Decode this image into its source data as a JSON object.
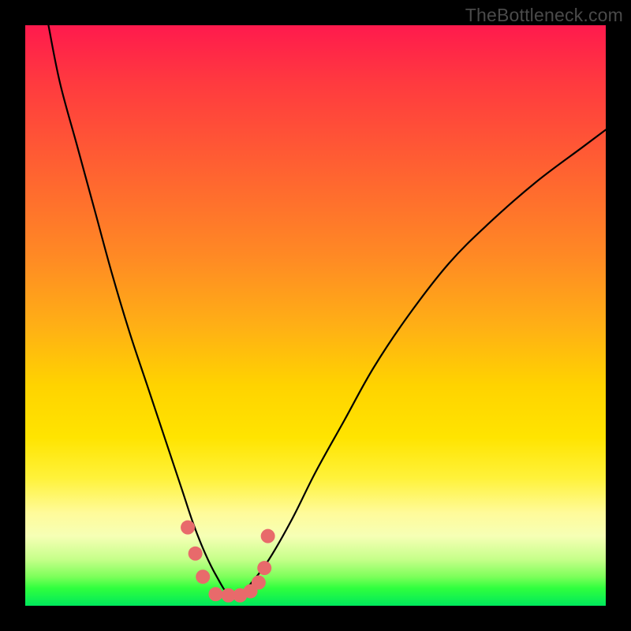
{
  "watermark": "TheBottleneck.com",
  "colors": {
    "frame_bg": "#000000",
    "curve_stroke": "#000000",
    "marker_fill": "#e86a6b",
    "marker_stroke": "#e86a6b",
    "gradient_stops": [
      {
        "pos": 0,
        "hex": "#ff1a4d"
      },
      {
        "pos": 10,
        "hex": "#ff3a3f"
      },
      {
        "pos": 25,
        "hex": "#ff6231"
      },
      {
        "pos": 40,
        "hex": "#ff8a24"
      },
      {
        "pos": 52,
        "hex": "#ffb015"
      },
      {
        "pos": 62,
        "hex": "#ffd300"
      },
      {
        "pos": 71,
        "hex": "#ffe400"
      },
      {
        "pos": 78,
        "hex": "#fff23a"
      },
      {
        "pos": 84,
        "hex": "#fffb9a"
      },
      {
        "pos": 88,
        "hex": "#f6ffb5"
      },
      {
        "pos": 92,
        "hex": "#c6ff8a"
      },
      {
        "pos": 95,
        "hex": "#7dff5a"
      },
      {
        "pos": 97,
        "hex": "#2fff3e"
      },
      {
        "pos": 100,
        "hex": "#00e85c"
      }
    ]
  },
  "chart_data": {
    "type": "line",
    "title": "",
    "xlabel": "",
    "ylabel": "",
    "xlim": [
      0,
      100
    ],
    "ylim": [
      0,
      100
    ],
    "note": "No axis tick labels are shown. x and y are estimated as percentages of the inner plot area; y=100 is top, y=0 is bottom. The curve resembles a bottleneck V-shape with its minimum near x≈35, and a cluster of marker points hugging the curve near the bottom of the dip.",
    "series": [
      {
        "name": "curve",
        "role": "line",
        "x": [
          4,
          6,
          9,
          12,
          15,
          18,
          21,
          24,
          27,
          29,
          31,
          33,
          35,
          37,
          39,
          42,
          46,
          50,
          55,
          60,
          66,
          73,
          80,
          88,
          96,
          100
        ],
        "y": [
          100,
          90,
          79,
          68,
          57,
          47,
          38,
          29,
          20,
          14,
          9,
          5,
          2,
          2,
          4,
          8,
          15,
          23,
          32,
          41,
          50,
          59,
          66,
          73,
          79,
          82
        ]
      },
      {
        "name": "markers",
        "role": "scatter",
        "x": [
          28.0,
          29.3,
          30.6,
          32.8,
          35.0,
          37.0,
          38.8,
          40.2,
          41.2,
          41.8
        ],
        "y": [
          13.5,
          9.0,
          5.0,
          2.0,
          1.8,
          1.8,
          2.5,
          4.0,
          6.5,
          12.0
        ],
        "marker_radius_px": 9
      }
    ]
  }
}
